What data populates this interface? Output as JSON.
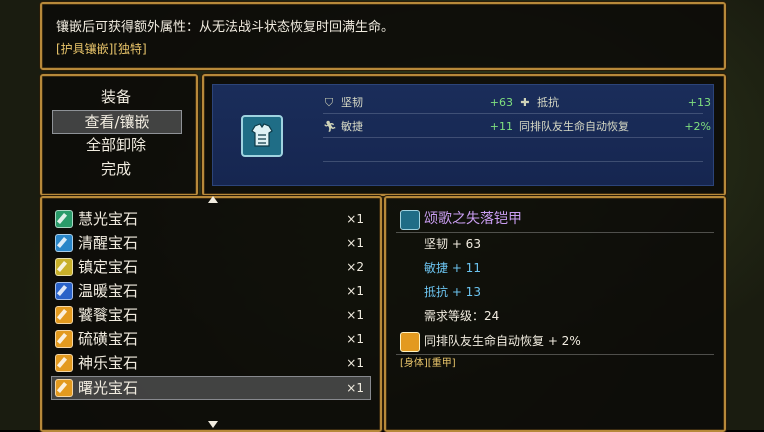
{
  "help": {
    "description": "镶嵌后可获得额外属性：从无法战斗状态恢复时回满生命。",
    "tags": "[护具镶嵌][独特]"
  },
  "command_menu": {
    "items": [
      "装备",
      "查看/镶嵌",
      "全部卸除",
      "完成"
    ],
    "selected_index": 1
  },
  "status": {
    "equip_icon": "armor-icon",
    "stats": [
      {
        "icon": "shield-icon",
        "label": "坚韧",
        "value": "+63"
      },
      {
        "icon": "cross-icon",
        "label": "抵抗",
        "value": "+13"
      },
      {
        "icon": "running-icon",
        "label": "敏捷",
        "value": "+11"
      },
      {
        "icon": "",
        "label": "同排队友生命自动恢复",
        "value": "+2%"
      }
    ]
  },
  "gems": [
    {
      "name": "慧光宝石",
      "count": "×1",
      "color": "#2a9b6a"
    },
    {
      "name": "清醒宝石",
      "count": "×1",
      "color": "#2a86c8"
    },
    {
      "name": "镇定宝石",
      "count": "×2",
      "color": "#c8b02a"
    },
    {
      "name": "温暖宝石",
      "count": "×1",
      "color": "#2a62c8"
    },
    {
      "name": "饕餮宝石",
      "count": "×1",
      "color": "#e39a1f"
    },
    {
      "name": "硫磺宝石",
      "count": "×1",
      "color": "#e39a1f"
    },
    {
      "name": "神乐宝石",
      "count": "×1",
      "color": "#e39a1f"
    },
    {
      "name": "曙光宝石",
      "count": "×1",
      "color": "#e39a1f"
    }
  ],
  "selected_gem_index": 7,
  "detail": {
    "title": "颂歌之失落铠甲",
    "lines": [
      {
        "text": "坚韧 + 63",
        "color": "white"
      },
      {
        "text": "敏捷 + 11",
        "color": "blue"
      },
      {
        "text": "抵抗 + 13",
        "color": "blue"
      },
      {
        "text": "需求等级：24",
        "color": "white"
      }
    ],
    "passive": "同排队友生命自动恢复 + 2%",
    "tags": "[身体][重甲]"
  }
}
